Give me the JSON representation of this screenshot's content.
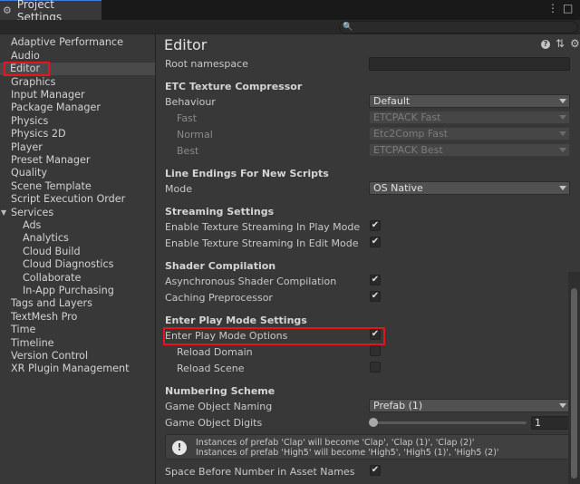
{
  "window": {
    "tab_title": "Project Settings",
    "menu_glyph": "⋮",
    "close_glyph": "□"
  },
  "sidebar": {
    "items": [
      {
        "label": "Adaptive Performance"
      },
      {
        "label": "Audio"
      },
      {
        "label": "Editor"
      },
      {
        "label": "Graphics"
      },
      {
        "label": "Input Manager"
      },
      {
        "label": "Package Manager"
      },
      {
        "label": "Physics"
      },
      {
        "label": "Physics 2D"
      },
      {
        "label": "Player"
      },
      {
        "label": "Preset Manager"
      },
      {
        "label": "Quality"
      },
      {
        "label": "Scene Template"
      },
      {
        "label": "Script Execution Order"
      },
      {
        "label": "Services"
      },
      {
        "label": "Ads"
      },
      {
        "label": "Analytics"
      },
      {
        "label": "Cloud Build"
      },
      {
        "label": "Cloud Diagnostics"
      },
      {
        "label": "Collaborate"
      },
      {
        "label": "In-App Purchasing"
      },
      {
        "label": "Tags and Layers"
      },
      {
        "label": "TextMesh Pro"
      },
      {
        "label": "Time"
      },
      {
        "label": "Timeline"
      },
      {
        "label": "Version Control"
      },
      {
        "label": "XR Plugin Management"
      }
    ]
  },
  "editor": {
    "title": "Editor",
    "root_namespace": {
      "label": "Root namespace",
      "value": ""
    },
    "etc": {
      "title": "ETC Texture Compressor",
      "behaviour": {
        "label": "Behaviour",
        "value": "Default"
      },
      "fast": {
        "label": "Fast",
        "value": "ETCPACK Fast"
      },
      "normal": {
        "label": "Normal",
        "value": "Etc2Comp Fast"
      },
      "best": {
        "label": "Best",
        "value": "ETCPACK Best"
      }
    },
    "line_endings": {
      "title": "Line Endings For New Scripts",
      "mode": {
        "label": "Mode",
        "value": "OS Native"
      }
    },
    "streaming": {
      "title": "Streaming Settings",
      "play": {
        "label": "Enable Texture Streaming In Play Mode",
        "checked": true
      },
      "edit": {
        "label": "Enable Texture Streaming In Edit Mode",
        "checked": true
      }
    },
    "shader": {
      "title": "Shader Compilation",
      "async": {
        "label": "Asynchronous Shader Compilation",
        "checked": true
      },
      "cache": {
        "label": "Caching Preprocessor",
        "checked": true
      }
    },
    "play_mode": {
      "title": "Enter Play Mode Settings",
      "options": {
        "label": "Enter Play Mode Options",
        "checked": true
      },
      "reload_domain": {
        "label": "Reload Domain",
        "checked": false
      },
      "reload_scene": {
        "label": "Reload Scene",
        "checked": false
      }
    },
    "numbering": {
      "title": "Numbering Scheme",
      "naming": {
        "label": "Game Object Naming",
        "value": "Prefab (1)"
      },
      "digits": {
        "label": "Game Object Digits",
        "value": "1"
      },
      "info_line1": "Instances of prefab 'Clap' will become 'Clap', 'Clap (1)', 'Clap (2)'",
      "info_line2": "Instances of prefab 'High5' will become 'High5', 'High5 (1)', 'High5 (2)'",
      "space": {
        "label": "Space Before Number in Asset Names",
        "checked": true
      }
    }
  },
  "check_glyph": "✔"
}
